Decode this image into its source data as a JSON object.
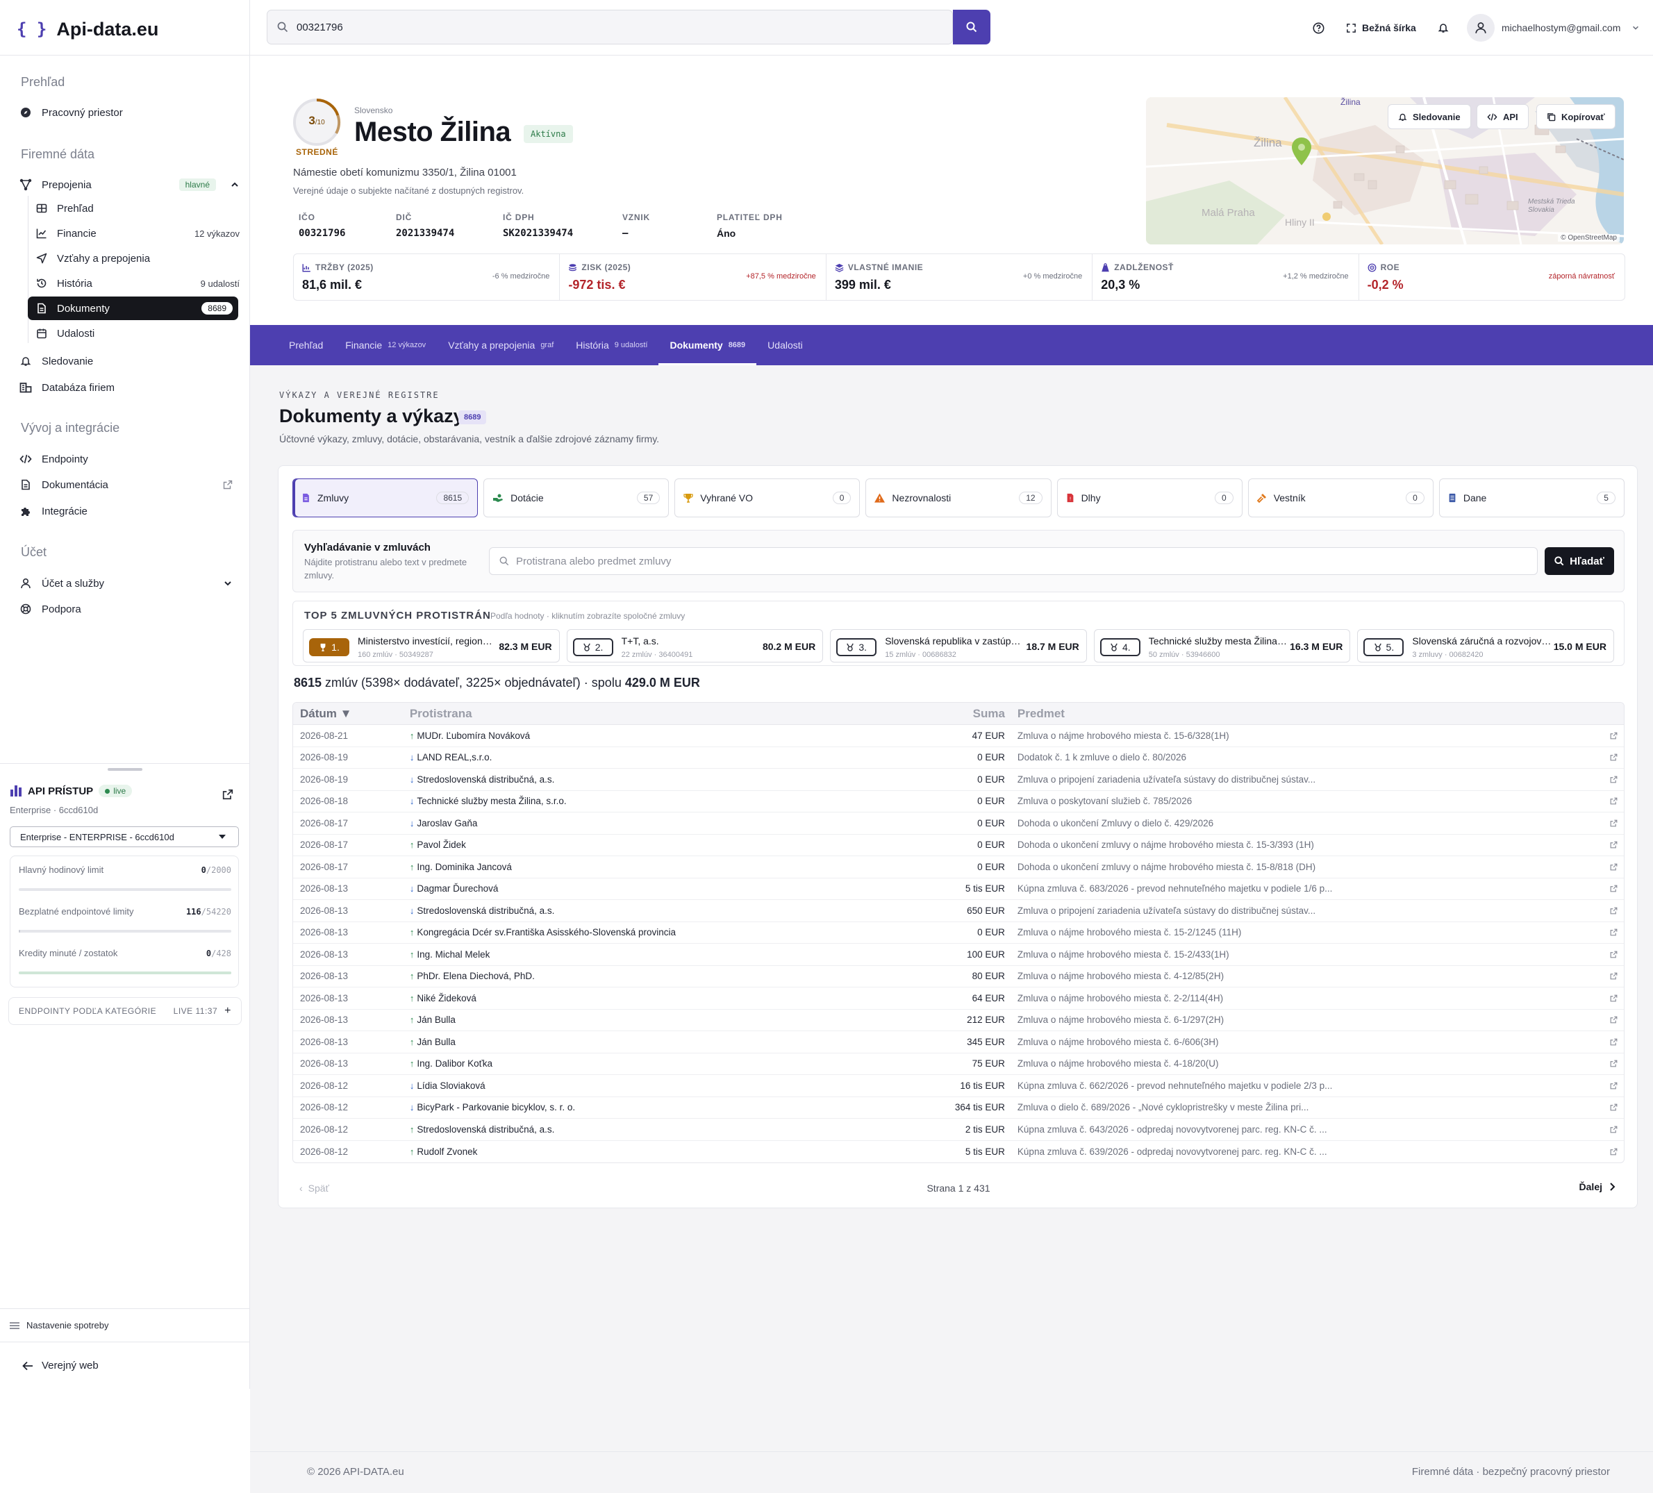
{
  "brand": {
    "mark": "{ }",
    "name": "Api-data.eu"
  },
  "sidebar": {
    "section_overview": "Prehľad",
    "workspace": "Pracovný priestor",
    "section_company": "Firemné dáta",
    "connections": {
      "label": "Prepojenia",
      "badge": "hlavné"
    },
    "sub": [
      {
        "label": "Prehľad",
        "count": ""
      },
      {
        "label": "Financie",
        "count": "12 výkazov"
      },
      {
        "label": "Vzťahy a prepojenia",
        "count": ""
      },
      {
        "label": "História",
        "count": "9 udalostí"
      },
      {
        "label": "Dokumenty",
        "count": "8689"
      },
      {
        "label": "Udalosti",
        "count": ""
      }
    ],
    "tracking": "Sledovanie",
    "company_db": "Databáza firiem",
    "section_dev": "Vývoj a integrácie",
    "endpoints": "Endpointy",
    "docs": "Dokumentácia",
    "integrations": "Integrácie",
    "section_account": "Účet",
    "account": "Účet a služby",
    "support": "Podpora"
  },
  "api_access": {
    "title": "API PRÍSTUP",
    "live": "live",
    "plan": "Enterprise · 6ccd610d",
    "select": "Enterprise - ENTERPRISE - 6ccd610d",
    "limits": [
      {
        "label": "Hlavný hodinový limit",
        "used": "0",
        "max": "/2000",
        "fraction": 0.0,
        "color": "#c9cbd3"
      },
      {
        "label": "Bezplatné endpointové limity",
        "used": "116",
        "max": "/54220",
        "fraction": 0.002,
        "color": "#c9cbd3"
      },
      {
        "label": "Kredity minuté / zostatok",
        "used": "0",
        "max": "/428",
        "fraction": 1.0,
        "color": "#cfe6d7"
      }
    ],
    "endpoints_cat": "ENDPOINTY PODĽA KATEGÓRIE",
    "endpoints_live": "LIVE 11:37",
    "consumption_settings": "Nastavenie spotreby",
    "public_web": "Verejný web"
  },
  "topbar": {
    "search_value": "00321796",
    "width_toggle": "Bežná šírka",
    "user_email": "michaelhostym@gmail.com"
  },
  "company": {
    "score": "3",
    "score_max": "/10",
    "score_label": "STREDNÉ",
    "country": "Slovensko",
    "name": "Mesto Žilina",
    "status": "Aktívna",
    "address": "Námestie obetí komunizmu 3350/1, Žilina 01001",
    "note": "Verejné údaje o subjekte načítané z dostupných registrov.",
    "fields": [
      {
        "key": "IČO",
        "value": "00321796"
      },
      {
        "key": "DIČ",
        "value": "2021339474"
      },
      {
        "key": "IČ DPH",
        "value": "SK2021339474"
      },
      {
        "key": "VZNIK",
        "value": "–"
      },
      {
        "key": "PLATITEĽ DPH",
        "value": "Áno"
      }
    ],
    "actions": {
      "follow": "Sledovanie",
      "api": "API",
      "copy": "Kopírovať"
    },
    "map": {
      "label_city": "Žilina",
      "label_city2": "Žilina",
      "label_area1": "Malá Praha",
      "label_area2": "Hliny II",
      "label_area3": "Mestská Trieda Slovakia",
      "attribution": "© OpenStreetMap"
    }
  },
  "kpis": [
    {
      "label": "TRŽBY (2025)",
      "value": "81,6 mil. €",
      "delta": "-6 % medziročne",
      "neg": false,
      "dcolor": "#6b6f7c",
      "icon": "chart-icon"
    },
    {
      "label": "ZISK (2025)",
      "value": "-972 tis. €",
      "delta": "+87,5 % medziročne",
      "neg": true,
      "dcolor": "#b3242a",
      "icon": "coins-icon"
    },
    {
      "label": "VLASTNÉ IMANIE",
      "value": "399 mil. €",
      "delta": "+0 % medziročne",
      "neg": false,
      "dcolor": "#6b6f7c",
      "icon": "layers-icon"
    },
    {
      "label": "ZADLŽENOSŤ",
      "value": "20,3 %",
      "delta": "+1,2 % medziročne",
      "neg": false,
      "dcolor": "#6b6f7c",
      "icon": "weight-icon"
    },
    {
      "label": "ROE",
      "value": "-0,2 %",
      "delta": "záporná návratnosť",
      "neg": true,
      "dcolor": "#b3242a",
      "icon": "target-icon"
    }
  ],
  "tabs": [
    {
      "label": "Prehľad",
      "count": ""
    },
    {
      "label": "Financie",
      "count": "12 výkazov"
    },
    {
      "label": "Vzťahy a prepojenia",
      "count": "graf"
    },
    {
      "label": "História",
      "count": "9 udalostí"
    },
    {
      "label": "Dokumenty",
      "count": "8689",
      "active": true
    },
    {
      "label": "Udalosti",
      "count": ""
    }
  ],
  "page": {
    "kicker": "VÝKAZY A VEREJNÉ REGISTRE",
    "title": "Dokumenty a výkazy",
    "count": "8689",
    "desc": "Účtovné výkazy, zmluvy, dotácie, obstarávania, vestník a ďalšie zdrojové záznamy firmy."
  },
  "categories": [
    {
      "label": "Zmluvy",
      "count": "8615",
      "color": "#7a5be0",
      "active": true
    },
    {
      "label": "Dotácie",
      "count": "57",
      "color": "#2c8a4f"
    },
    {
      "label": "Vyhrané VO",
      "count": "0",
      "color": "#d89a0f"
    },
    {
      "label": "Nezrovnalosti",
      "count": "12",
      "color": "#e06a1a"
    },
    {
      "label": "Dlhy",
      "count": "0",
      "color": "#d8343a"
    },
    {
      "label": "Vestník",
      "count": "0",
      "color": "#e0781a"
    },
    {
      "label": "Dane",
      "count": "5",
      "color": "#3d5aa8"
    }
  ],
  "contract_search": {
    "title": "Vyhľadávanie v zmluvách",
    "desc": "Nájdite protistranu alebo text v predmete zmluvy.",
    "placeholder": "Protistrana alebo predmet zmluvy",
    "button": "Hľadať"
  },
  "top5": {
    "title": "TOP 5 ZMLUVNÝCH PROTISTRÁN",
    "hint": "Podľa hodnoty · kliknutím zobrazíte spoločné zmluvy",
    "items": [
      {
        "rank": "1.",
        "name": "Ministerstvo investícií, regionálneho rozvoja",
        "meta": "160 zmlúv · 50349287",
        "amount": "82.3 M EUR"
      },
      {
        "rank": "2.",
        "name": "T+T, a.s.",
        "meta": "22 zmlúv · 36400491",
        "amount": "80.2 M EUR"
      },
      {
        "rank": "3.",
        "name": "Slovenská republika v zastúpení",
        "meta": "15 zmlúv · 00686832",
        "amount": "18.7 M EUR"
      },
      {
        "rank": "4.",
        "name": "Technické služby mesta Žilina, s.r.o.",
        "meta": "50 zmlúv · 53946600",
        "amount": "16.3 M EUR"
      },
      {
        "rank": "5.",
        "name": "Slovenská záručná a rozvojová banka",
        "meta": "3 zmluvy · 00682420",
        "amount": "15.0 M EUR"
      }
    ]
  },
  "summary": {
    "count": "8615",
    "text": " zmlúv (5398× dodávateľ, 3225× objednávateľ) · spolu ",
    "total": "429.0 M EUR"
  },
  "table": {
    "headers": {
      "date": "Dátum ▼",
      "party": "Protistrana",
      "amount": "Suma",
      "subject": "Predmet"
    },
    "rows": [
      {
        "date": "2026-08-21",
        "dir": "up",
        "party": "MUDr. Ľubomíra Nováková",
        "amount": "47 EUR",
        "subject": "Zmluva o nájme hrobového miesta č. 15-6/328(1H)"
      },
      {
        "date": "2026-08-19",
        "dir": "down",
        "party": "LAND REAL,s.r.o.",
        "amount": "0 EUR",
        "subject": "Dodatok č. 1 k zmluve o dielo č. 80/2026"
      },
      {
        "date": "2026-08-19",
        "dir": "down",
        "party": "Stredoslovenská distribučná, a.s.",
        "amount": "0 EUR",
        "subject": "Zmluva o pripojení zariadenia užívateľa sústavy do distribučnej sústav..."
      },
      {
        "date": "2026-08-18",
        "dir": "down",
        "party": "Technické služby mesta Žilina, s.r.o.",
        "amount": "0 EUR",
        "subject": "Zmluva o poskytovaní služieb č. 785/2026"
      },
      {
        "date": "2026-08-17",
        "dir": "down",
        "party": "Jaroslav Gaňa",
        "amount": "0 EUR",
        "subject": "Dohoda o ukončení Zmluvy o dielo č. 429/2026"
      },
      {
        "date": "2026-08-17",
        "dir": "up",
        "party": "Pavol Židek",
        "amount": "0 EUR",
        "subject": "Dohoda o ukončení zmluvy o nájme hrobového miesta č. 15-3/393 (1H)"
      },
      {
        "date": "2026-08-17",
        "dir": "up",
        "party": "Ing. Dominika Jancová",
        "amount": "0 EUR",
        "subject": "Dohoda o ukončení zmluvy o nájme hrobového miesta č. 15-8/818 (DH)"
      },
      {
        "date": "2026-08-13",
        "dir": "down",
        "party": "Dagmar Ďurechová",
        "amount": "5 tis EUR",
        "subject": "Kúpna zmluva č. 683/2026 - prevod nehnuteľného majetku v podiele 1/6 p..."
      },
      {
        "date": "2026-08-13",
        "dir": "down",
        "party": "Stredoslovenská distribučná, a.s.",
        "amount": "650 EUR",
        "subject": "Zmluva o pripojení zariadenia užívateľa sústavy do distribučnej sústav..."
      },
      {
        "date": "2026-08-13",
        "dir": "up",
        "party": "Kongregácia Dcér sv.Františka Asisského-Slovenská provincia",
        "amount": "0 EUR",
        "subject": "Zmluva o nájme hrobového miesta č. 15-2/1245 (11H)"
      },
      {
        "date": "2026-08-13",
        "dir": "up",
        "party": "Ing. Michal Melek",
        "amount": "100 EUR",
        "subject": "Zmluva o nájme hrobového miesta č. 15-2/433(1H)"
      },
      {
        "date": "2026-08-13",
        "dir": "up",
        "party": "PhDr. Elena Diechová, PhD.",
        "amount": "80 EUR",
        "subject": "Zmluva o nájme hrobového miesta č. 4-12/85(2H)"
      },
      {
        "date": "2026-08-13",
        "dir": "up",
        "party": "Niké Žideková",
        "amount": "64 EUR",
        "subject": "Zmluva o nájme hrobového miesta č. 2-2/114(4H)"
      },
      {
        "date": "2026-08-13",
        "dir": "up",
        "party": "Ján Bulla",
        "amount": "212 EUR",
        "subject": "Zmluva o nájme hrobového miesta č. 6-1/297(2H)"
      },
      {
        "date": "2026-08-13",
        "dir": "up",
        "party": "Ján Bulla",
        "amount": "345 EUR",
        "subject": "Zmluva o nájme hrobového miesta č. 6-/606(3H)"
      },
      {
        "date": "2026-08-13",
        "dir": "up",
        "party": "Ing. Dalibor Koťka",
        "amount": "75 EUR",
        "subject": "Zmluva o nájme hrobového miesta č. 4-18/20(U)"
      },
      {
        "date": "2026-08-12",
        "dir": "down",
        "party": "Lídia Sloviaková",
        "amount": "16 tis EUR",
        "subject": "Kúpna zmluva č. 662/2026 - prevod nehnuteľného majetku v podiele 2/3 p..."
      },
      {
        "date": "2026-08-12",
        "dir": "down",
        "party": "BicyPark - Parkovanie bicyklov, s. r. o.",
        "amount": "364 tis EUR",
        "subject": "Zmluva o dielo č. 689/2026 - „Nové cyklopristrešky v meste Žilina pri..."
      },
      {
        "date": "2026-08-12",
        "dir": "up",
        "party": "Stredoslovenská distribučná, a.s.",
        "amount": "2 tis EUR",
        "subject": "Kúpna zmluva č. 643/2026 - odpredaj novovytvorenej parc. reg. KN-C č. ..."
      },
      {
        "date": "2026-08-12",
        "dir": "up",
        "party": "Rudolf Zvonek",
        "amount": "5 tis EUR",
        "subject": "Kúpna zmluva č. 639/2026 - odpredaj novovytvorenej parc. reg. KN-C č. ..."
      }
    ]
  },
  "pager": {
    "prev": "Späť",
    "status": "Strana 1 z 431",
    "next": "Ďalej"
  },
  "footer": {
    "left": "© 2026 API-DATA.eu",
    "right": "Firemné dáta · bezpečný pracovný priestor"
  }
}
